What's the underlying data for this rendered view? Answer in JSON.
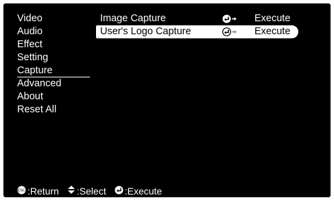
{
  "menu": {
    "items": [
      {
        "label": "Video"
      },
      {
        "label": "Audio"
      },
      {
        "label": "Effect"
      },
      {
        "label": "Setting"
      },
      {
        "label": "Capture"
      },
      {
        "label": "Advanced"
      },
      {
        "label": "About"
      },
      {
        "label": "Reset All"
      }
    ],
    "active": "Capture"
  },
  "rows": [
    {
      "label": "Image Capture",
      "icon": "enter-arrow-icon",
      "value": "Execute"
    },
    {
      "label": "User's Logo Capture",
      "icon": "enter-arrow-icon",
      "value": "Execute"
    }
  ],
  "footer": {
    "return_label": ":Return",
    "select_label": ":Select",
    "execute_label": ":Execute"
  },
  "colors": {
    "background": "#000000",
    "text": "#ffffff",
    "highlight": "#ffffff",
    "highlight_text": "#000000"
  }
}
